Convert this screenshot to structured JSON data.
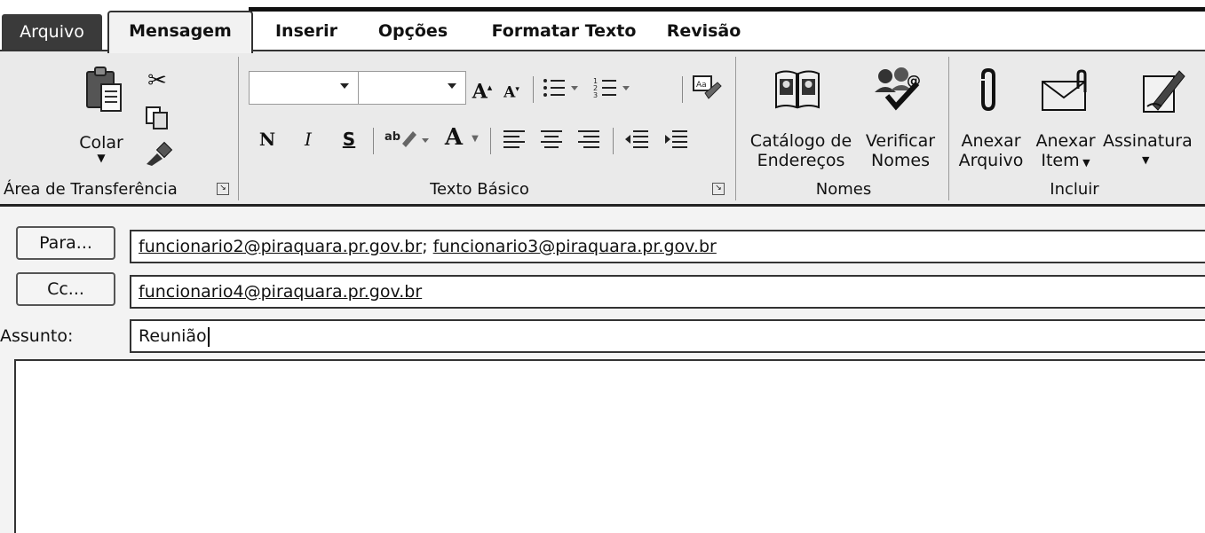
{
  "tabs": {
    "file": "Arquivo",
    "message": "Mensagem",
    "insert": "Inserir",
    "options": "Opções",
    "format_text": "Formatar Texto",
    "review": "Revisão"
  },
  "ribbon": {
    "clipboard": {
      "paste_label": "Colar",
      "group_label": "Área de Transferência",
      "icons": [
        "paste-icon",
        "cut-icon",
        "copy-icon",
        "format-painter-icon"
      ]
    },
    "basic_text": {
      "group_label": "Texto Básico",
      "bold": "N",
      "italic": "I",
      "underline": "S",
      "font_color_glyph": "A",
      "grow_font": "A",
      "shrink_font": "A"
    },
    "names": {
      "group_label": "Nomes",
      "address_book_line1": "Catálogo de",
      "address_book_line2": "Endereços",
      "check_names_line1": "Verificar",
      "check_names_line2": "Nomes"
    },
    "include": {
      "group_label": "Incluir",
      "attach_file_line1": "Anexar",
      "attach_file_line2": "Arquivo",
      "attach_item_line1": "Anexar",
      "attach_item_line2": "Item",
      "signature_line1": "Assinatura"
    }
  },
  "compose": {
    "to_button": "Para...",
    "cc_button": "Cc...",
    "subject_label": "Assunto:",
    "to_addr1": "funcionario2@piraquara.pr.gov.br",
    "to_separator": "; ",
    "to_addr2": "funcionario3@piraquara.pr.gov.br",
    "cc_addr1": "funcionario4@piraquara.pr.gov.br",
    "subject_value": "Reunião",
    "body": ""
  }
}
